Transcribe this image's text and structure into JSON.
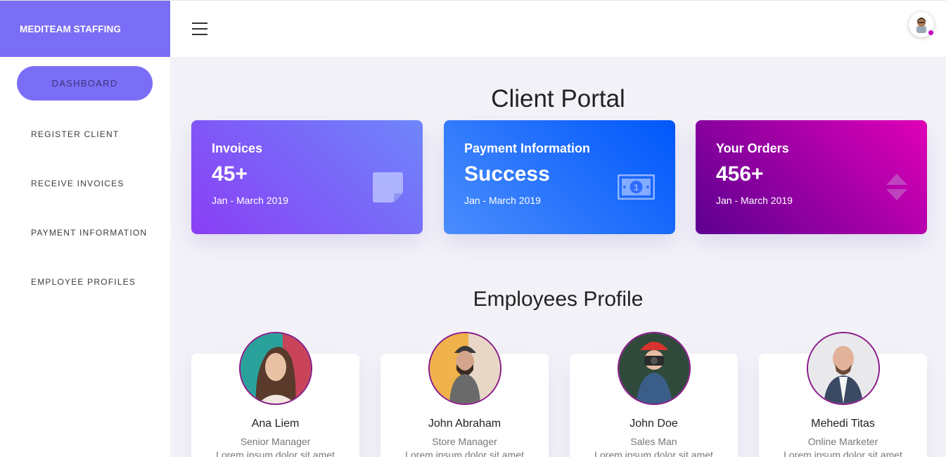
{
  "brand": "MEDITEAM STAFFING",
  "sidebar": {
    "active": "DASHBOARD",
    "items": [
      "REGISTER CLIENT",
      "RECEIVE INVOICES",
      "PAYMENT INFORMATION",
      "EMPLOYEE PROFILES"
    ]
  },
  "topbar": {
    "menu_icon": "hamburger-icon",
    "avatar_icon": "user-avatar-icon",
    "status_color": "#c000c0"
  },
  "main": {
    "title": "Client Portal",
    "cards": [
      {
        "label": "Invoices",
        "value": "45+",
        "period": "Jan - March 2019",
        "icon": "sticky-note-icon"
      },
      {
        "label": "Payment Information",
        "value": "Success",
        "period": "Jan - March 2019",
        "icon": "money-bill-icon"
      },
      {
        "label": "Your Orders",
        "value": "456+",
        "period": "Jan - March 2019",
        "icon": "sort-icon"
      }
    ],
    "profiles_title": "Employees Profile",
    "profiles": [
      {
        "name": "Ana Liem",
        "role": "Senior Manager",
        "desc": "Lorem ipsum dolor sit amet"
      },
      {
        "name": "John Abraham",
        "role": "Store Manager",
        "desc": "Lorem ipsum dolor sit amet"
      },
      {
        "name": "John Doe",
        "role": "Sales Man",
        "desc": "Lorem ipsum dolor sit amet"
      },
      {
        "name": "Mehedi Titas",
        "role": "Online Marketer",
        "desc": "Lorem ipsum dolor sit amet"
      }
    ]
  },
  "colors": {
    "accent": "#7b6ef6",
    "profile_ring": "#8a1a8a"
  }
}
